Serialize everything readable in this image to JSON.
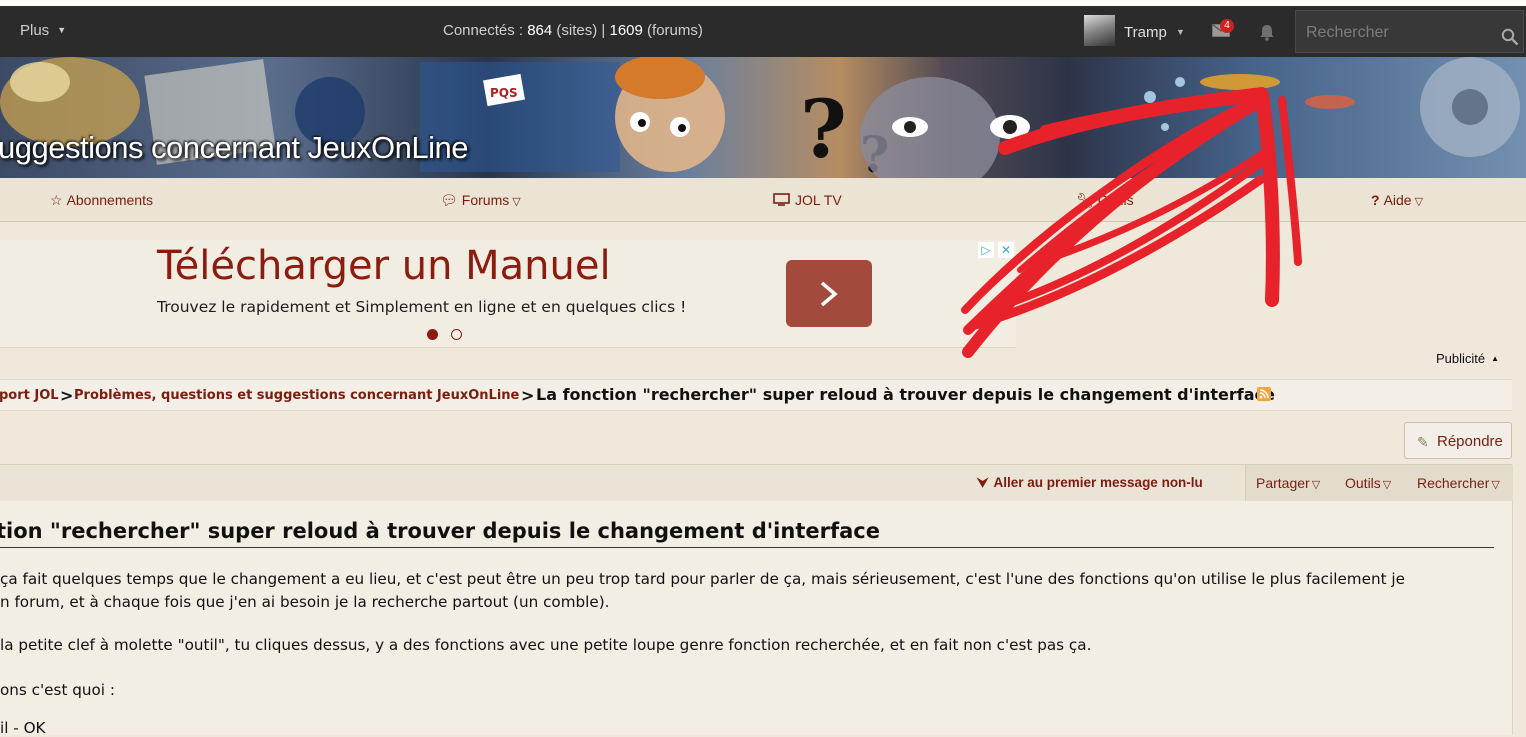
{
  "topbar": {
    "more_label": "Plus",
    "online_prefix": "Connectés : ",
    "online_sites": "864",
    "online_sites_suffix": " (sites) | ",
    "online_forums": "1609",
    "online_forums_suffix": " (forums)",
    "username": "Tramp",
    "mail_count": "4",
    "search_placeholder": "Rechercher"
  },
  "banner": {
    "title": "uggestions concernant JeuxOnLine"
  },
  "nav": {
    "items": [
      {
        "label": "Abonnements"
      },
      {
        "label": "Forums"
      },
      {
        "label": "JOL TV"
      },
      {
        "label": "Outils"
      },
      {
        "label": "Aide"
      }
    ]
  },
  "ad": {
    "title": "Télécharger un Manuel",
    "subtitle": "Trouvez le rapidement et Simplement en ligne et en quelques clics !",
    "label": "Publicité"
  },
  "breadcrumb": {
    "items": [
      "port JOL",
      "Problèmes, questions et suggestions concernant JeuxOnLine"
    ],
    "separator": ">",
    "current": "La fonction \"rechercher\" super reloud à trouver depuis le changement d'interface"
  },
  "actions": {
    "reply_label": "Répondre",
    "unread_label": "Aller au premier message non-lu",
    "share_label": "Partager",
    "tools_label": "Outils",
    "search_label": "Rechercher"
  },
  "post": {
    "title": "tion \"rechercher\" super reloud à trouver depuis le changement d'interface",
    "lines": [
      "ça fait quelques temps que le changement a eu lieu, et c'est peut être un peu trop tard pour parler de ça, mais sérieusement, c'est l'une des fonctions qu'on utilise le plus facilement je",
      "n forum, et à chaque fois que j'en ai besoin je la recherche partout (un comble).",
      " la petite clef à molette \"outil\", tu cliques dessus, y a des fonctions avec une petite loupe genre fonction recherchée, et en fait non c'est pas ça.",
      "ons c'est quoi :",
      "il - OK"
    ]
  },
  "colors": {
    "accent": "#7a1d10",
    "topbar_bg": "#2b2b2b",
    "badge": "#d0201f",
    "annotation": "#e8222a"
  }
}
